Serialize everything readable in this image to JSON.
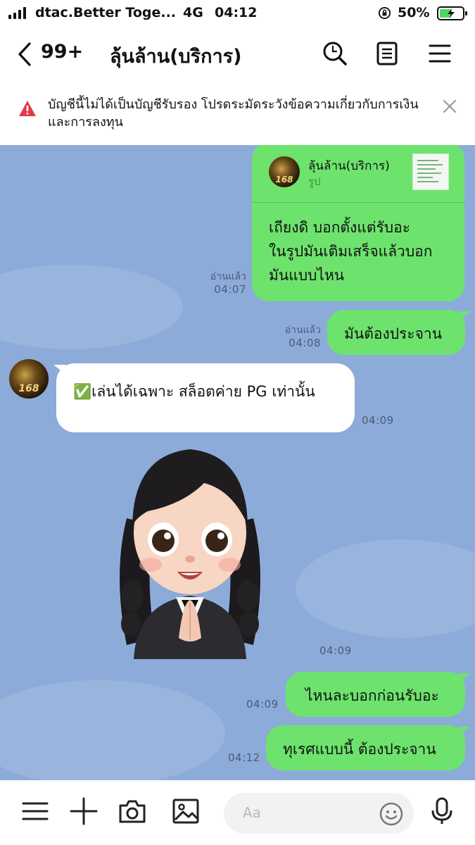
{
  "status_bar": {
    "carrier": "dtac.Better Toge...",
    "network": "4G",
    "time": "04:12",
    "battery": "50%"
  },
  "header": {
    "unread_count": "99+",
    "chat_name": "ลุ้นล้าน(บริการ)"
  },
  "warning": {
    "text": "บัญชีนี้ไม่ได้เป็นบัญชีรับรอง โปรดระมัดระวังข้อความเกี่ยวกับการเงินและการลงทุน"
  },
  "messages": [
    {
      "reply_to": {
        "sender": "ลุ้นล้าน(บริการ)",
        "type": "รูป"
      },
      "lines": [
        "เถียงดิ บอกตั้งแต่รับอะ",
        "ในรูปมันเติมเสร็จแล้วบอก",
        "มันแบบไหน"
      ],
      "read": "อ่านแล้ว",
      "time": "04:07"
    },
    {
      "text": "มันต้องประจาน",
      "read": "อ่านแล้ว",
      "time": "04:08"
    },
    {
      "text": "✅เล่นได้เฉพาะ สล็อตค่าย PG  เท่านั้น",
      "time": "04:09",
      "avatar_text": "168"
    },
    {
      "sticker": "girl-wai-sticker",
      "time": "04:09"
    },
    {
      "text": "ไหนละบอกก่อนรับอะ",
      "time": "04:09"
    },
    {
      "text": "ทุเรศแบบนี้ ต้องประจาน",
      "time": "04:12"
    }
  ],
  "input": {
    "placeholder": "Aa"
  },
  "colors": {
    "chat_bg": "#8dabd9",
    "own_bubble": "#6de36d",
    "other_bubble": "#ffffff",
    "warning_icon": "#e53945"
  }
}
